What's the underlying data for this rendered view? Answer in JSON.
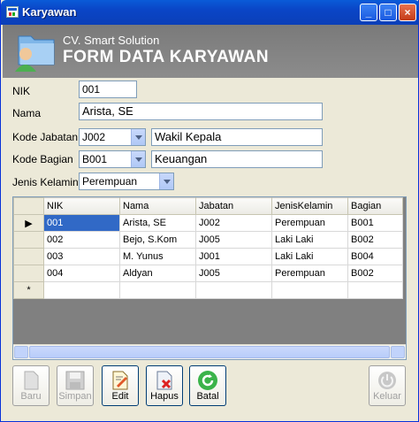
{
  "window": {
    "title": "Karyawan",
    "minimize": "_",
    "maximize": "□",
    "close": "×"
  },
  "header": {
    "company": "CV. Smart Solution",
    "form_title": "FORM DATA KARYAWAN"
  },
  "form": {
    "nik_label": "NIK",
    "nik_value": "001",
    "nama_label": "Nama",
    "nama_value": "Arista, SE",
    "kode_jabatan_label": "Kode Jabatan",
    "kode_jabatan_value": "J002",
    "jabatan_name": "Wakil Kepala",
    "kode_bagian_label": "Kode Bagian",
    "kode_bagian_value": "B001",
    "bagian_name": "Keuangan",
    "jenis_kelamin_label": "Jenis Kelamin",
    "jenis_kelamin_value": "Perempuan"
  },
  "grid": {
    "columns": [
      "NIK",
      "Nama",
      "Jabatan",
      "JenisKelamin",
      "Bagian"
    ],
    "rows": [
      [
        "001",
        "Arista, SE",
        "J002",
        "Perempuan",
        "B001"
      ],
      [
        "002",
        "Bejo, S.Kom",
        "J005",
        "Laki Laki",
        "B002"
      ],
      [
        "003",
        "M. Yunus",
        "J001",
        "Laki Laki",
        "B004"
      ],
      [
        "004",
        "Aldyan",
        "J005",
        "Perempuan",
        "B002"
      ]
    ],
    "current_row_marker": "▶",
    "new_row_marker": "*"
  },
  "buttons": {
    "baru": "Baru",
    "simpan": "Simpan",
    "edit": "Edit",
    "hapus": "Hapus",
    "batal": "Batal",
    "keluar": "Keluar"
  },
  "icons": {
    "header": "folder-user-icon",
    "baru": "new-document-icon",
    "simpan": "floppy-disk-icon",
    "edit": "edit-document-icon",
    "hapus": "delete-document-icon",
    "batal": "refresh-icon",
    "keluar": "power-icon"
  },
  "colors": {
    "title_bar": "#0a45c6",
    "header_band": "#808080",
    "selection": "#3169c6",
    "close_button": "#c43b17"
  }
}
